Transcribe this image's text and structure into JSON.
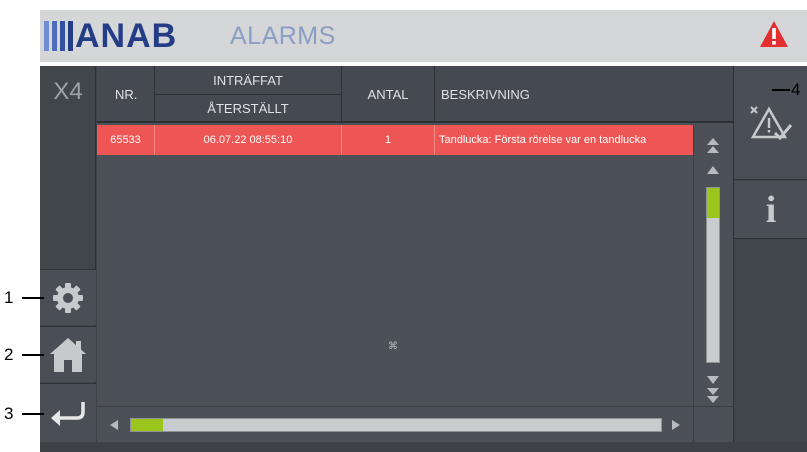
{
  "header": {
    "logo_text": "ANAB",
    "title": "ALARMS",
    "logo_bar_colors": [
      "#6f8ccf",
      "#4d6cbd",
      "#34529f",
      "#253d86"
    ],
    "alarm_icon": "warning-triangle-icon",
    "alarm_color": "#e3302f"
  },
  "left": {
    "station": "X4",
    "settings_icon": "gear-icon",
    "home_icon": "home-icon",
    "back_icon": "return-arrow-icon"
  },
  "table": {
    "columns": {
      "nr": "NR.",
      "occurred": "INTRÄFFAT",
      "reset": "ÅTERSTÄLLT",
      "count": "ANTAL",
      "description": "BESKRIVNING"
    },
    "rows": [
      {
        "nr": "65533",
        "occurred": "06.07.22  08:55:10",
        "count": "1",
        "description": "Tandlucka: Första rörelse var en tandlucka"
      }
    ],
    "row_color": "#ee5555",
    "center_marker": "⌘"
  },
  "scroll": {
    "vertical_position": 0.0,
    "horizontal_position": 0.0,
    "thumb_color": "#9cc51e"
  },
  "right": {
    "acknowledge_icon": "acknowledge-alarm-icon",
    "info_icon": "info-icon",
    "info_glyph": "i"
  },
  "callouts": [
    "1",
    "2",
    "3",
    "4"
  ]
}
